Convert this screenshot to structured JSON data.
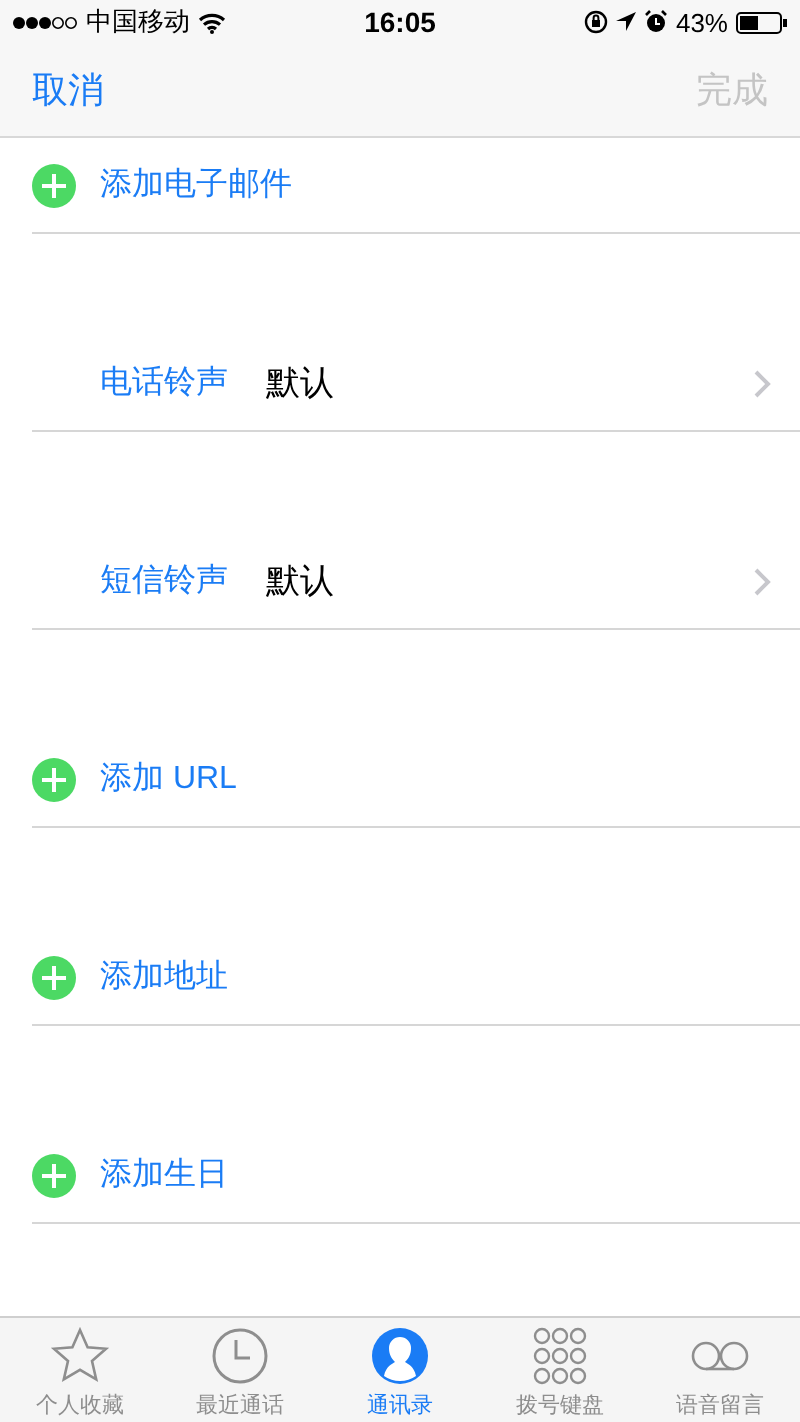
{
  "status_bar": {
    "carrier": "中国移动",
    "time": "16:05",
    "battery": "43%"
  },
  "nav": {
    "cancel": "取消",
    "done": {
      "label": "完成",
      "disabled": true
    }
  },
  "rows": [
    {
      "kind": "add",
      "label": "添加电子邮件"
    },
    {
      "kind": "setting",
      "label": "电话铃声",
      "value": "默认"
    },
    {
      "kind": "setting",
      "label": "短信铃声",
      "value": "默认"
    },
    {
      "kind": "add",
      "label": "添加 URL"
    },
    {
      "kind": "add",
      "label": "添加地址"
    },
    {
      "kind": "add",
      "label": "添加生日"
    }
  ],
  "tabs": [
    {
      "kind": "star",
      "label": "个人收藏",
      "selected": false
    },
    {
      "kind": "clock",
      "label": "最近通话",
      "selected": false
    },
    {
      "kind": "person",
      "label": "通讯录",
      "selected": true
    },
    {
      "kind": "keypad",
      "label": "拨号键盘",
      "selected": false
    },
    {
      "kind": "voicemail",
      "label": "语音留言",
      "selected": false
    }
  ]
}
